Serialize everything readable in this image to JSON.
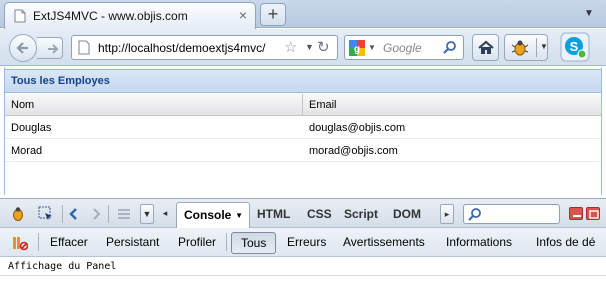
{
  "browser": {
    "tab_title": "ExtJS4MVC - www.objis.com",
    "tab_close": "×",
    "new_tab": "+",
    "url": "http://localhost/demoextjs4mvc/",
    "search_placeholder": "Google",
    "search_engine_icon": "google-icon"
  },
  "panel": {
    "title": "Tous les Employes",
    "columns": [
      "Nom",
      "Email"
    ],
    "rows": [
      {
        "nom": "Douglas",
        "email": "douglas@objis.com"
      },
      {
        "nom": "Morad",
        "email": "morad@objis.com"
      }
    ]
  },
  "firebug": {
    "tabs": {
      "console": "Console",
      "html": "HTML",
      "css": "CSS",
      "script": "Script",
      "dom": "DOM"
    },
    "filters": {
      "clear": "Effacer",
      "persist": "Persistant",
      "profile": "Profiler",
      "all": "Tous",
      "errors": "Erreurs",
      "warnings": "Avertissements",
      "info": "Informations",
      "debug": "Infos de dé"
    },
    "console_output": "Affichage du Panel"
  },
  "colors": {
    "panel_title": "#15428b",
    "panel_border": "#99bbe8",
    "chrome_bg": "#d3dfec"
  }
}
